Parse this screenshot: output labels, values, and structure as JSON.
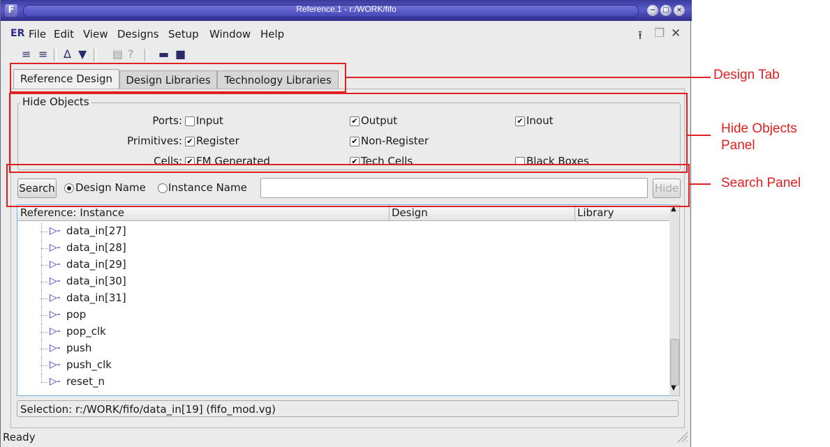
{
  "window": {
    "logo_letter": "F",
    "title": "Reference.1 - r:/WORK/fifo",
    "buttons": [
      "−",
      "□",
      "×"
    ]
  },
  "menubar": {
    "app_icon": "ER",
    "items": [
      "File",
      "Edit",
      "View",
      "Designs",
      "Setup",
      "Window",
      "Help"
    ],
    "mdi_buttons": [
      "⭱",
      "❐",
      "✕"
    ]
  },
  "toolbar": {
    "icons": [
      "reference-down-icon",
      "reference-instance-icon",
      "binoculars-icon",
      "filter-icon",
      "report-icon",
      "help-icon",
      "open-folder-icon",
      "save-icon"
    ],
    "glyphs": [
      "≡",
      "≡",
      "Δ",
      "▼",
      "▤",
      "?",
      "▬",
      "■"
    ]
  },
  "tabs": [
    "Reference Design",
    "Design Libraries",
    "Technology Libraries"
  ],
  "hide_objects": {
    "title": "Hide Objects",
    "rows": [
      {
        "label": "Ports:",
        "options": [
          {
            "text": "Input",
            "checked": false
          },
          {
            "text": "Output",
            "checked": true
          },
          {
            "text": "Inout",
            "checked": true
          }
        ]
      },
      {
        "label": "Primitives:",
        "options": [
          {
            "text": "Register",
            "checked": true
          },
          {
            "text": "Non-Register",
            "checked": true
          }
        ]
      },
      {
        "label": "Cells:",
        "options": [
          {
            "text": "FM Generated",
            "checked": true
          },
          {
            "text": "Tech Cells",
            "checked": true
          },
          {
            "text": "Black Boxes",
            "checked": false
          }
        ]
      }
    ]
  },
  "search": {
    "button": "Search",
    "radio_design": "Design Name",
    "radio_instance": "Instance Name",
    "selected": "Design Name",
    "input_value": "",
    "hide_button": "Hide"
  },
  "tree": {
    "columns": [
      "Reference: Instance",
      "Design",
      "Library"
    ],
    "rows": [
      "data_in[27]",
      "data_in[28]",
      "data_in[29]",
      "data_in[30]",
      "data_in[31]",
      "pop",
      "pop_clk",
      "push",
      "push_clk",
      "reset_n"
    ],
    "port_glyph": "▷-"
  },
  "selection": "Selection: r:/WORK/fifo/data_in[19] (fifo_mod.vg)",
  "status": "Ready",
  "annotations": {
    "design_tab": "Design Tab",
    "hide_objects_panel": "Hide Objects Panel",
    "search_panel": "Search Panel",
    "color": "#e02020"
  }
}
